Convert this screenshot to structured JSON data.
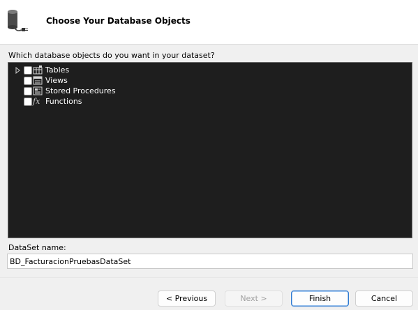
{
  "header": {
    "title": "Choose Your Database Objects",
    "icon": "database-connection-icon"
  },
  "prompt": "Which database objects do you want in your dataset?",
  "tree": {
    "items": [
      {
        "label": "Tables",
        "icon": "table-icon",
        "checked": false,
        "expandable": true
      },
      {
        "label": "Views",
        "icon": "view-icon",
        "checked": false,
        "expandable": false
      },
      {
        "label": "Stored Procedures",
        "icon": "stored-procedure-icon",
        "checked": false,
        "expandable": false
      },
      {
        "label": "Functions",
        "icon": "function-icon",
        "glyph": "fx",
        "checked": false,
        "expandable": false
      }
    ],
    "background": "#1e1e1e"
  },
  "dataset": {
    "label": "DataSet name:",
    "value": "BD_FacturacionPruebasDataSet"
  },
  "buttons": {
    "previous": "< Previous",
    "next": "Next >",
    "finish": "Finish",
    "cancel": "Cancel"
  },
  "colors": {
    "accent": "#2f7ad1"
  }
}
